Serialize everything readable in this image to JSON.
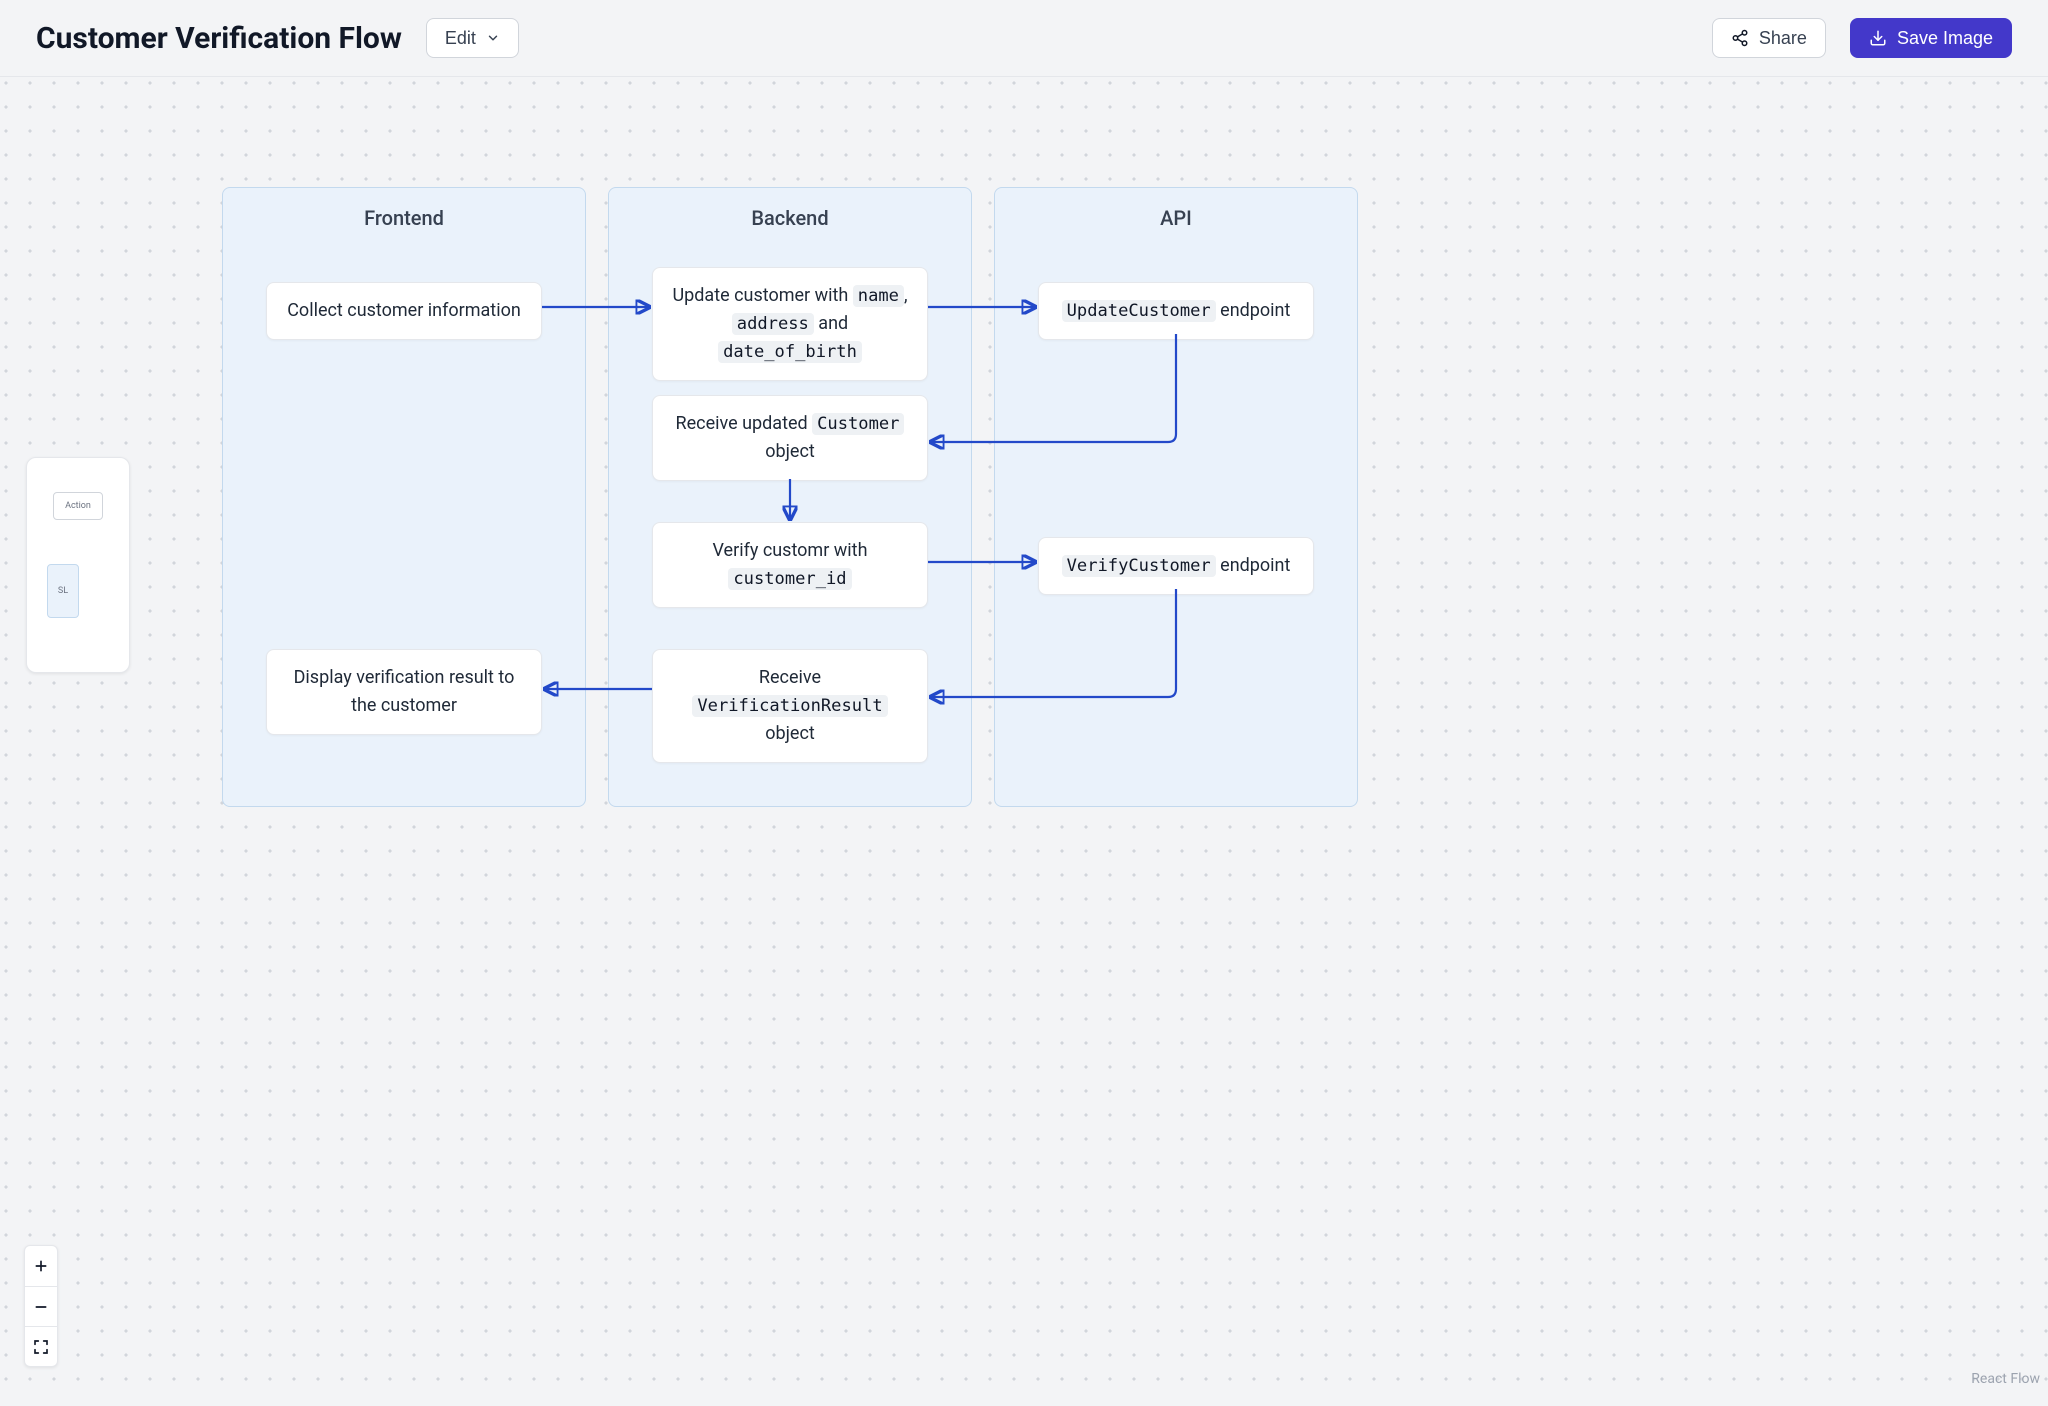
{
  "header": {
    "title": "Customer Verification Flow",
    "edit_label": "Edit",
    "share_label": "Share",
    "save_label": "Save Image"
  },
  "lanes": {
    "frontend": "Frontend",
    "backend": "Backend",
    "api": "API"
  },
  "nodes": {
    "collect": "Collect customer information",
    "update_prefix": "Update customer with ",
    "update_code1": "name",
    "update_sep1": ", ",
    "update_code2": "address",
    "update_sep2": " and ",
    "update_code3": "date_of_birth",
    "update_api_code": "UpdateCustomer",
    "update_api_suffix": " endpoint",
    "receive_cust_prefix": "Receive updated ",
    "receive_cust_code": "Customer",
    "receive_cust_suffix": " object",
    "verify_prefix": "Verify customr with ",
    "verify_code": "customer_id",
    "verify_api_code": "VerifyCustomer",
    "verify_api_suffix": " endpoint",
    "receive_vr_prefix": "Receive ",
    "receive_vr_code": "VerificationResult",
    "receive_vr_suffix": " object",
    "display": "Display verification result to the customer"
  },
  "minimap": {
    "action": "Action",
    "sl": "SL"
  },
  "attribution": "React Flow",
  "colors": {
    "accent": "#4338ca",
    "edge": "#2349c9",
    "lane_bg": "#eaf2fb",
    "lane_border": "#c3d9ee"
  }
}
